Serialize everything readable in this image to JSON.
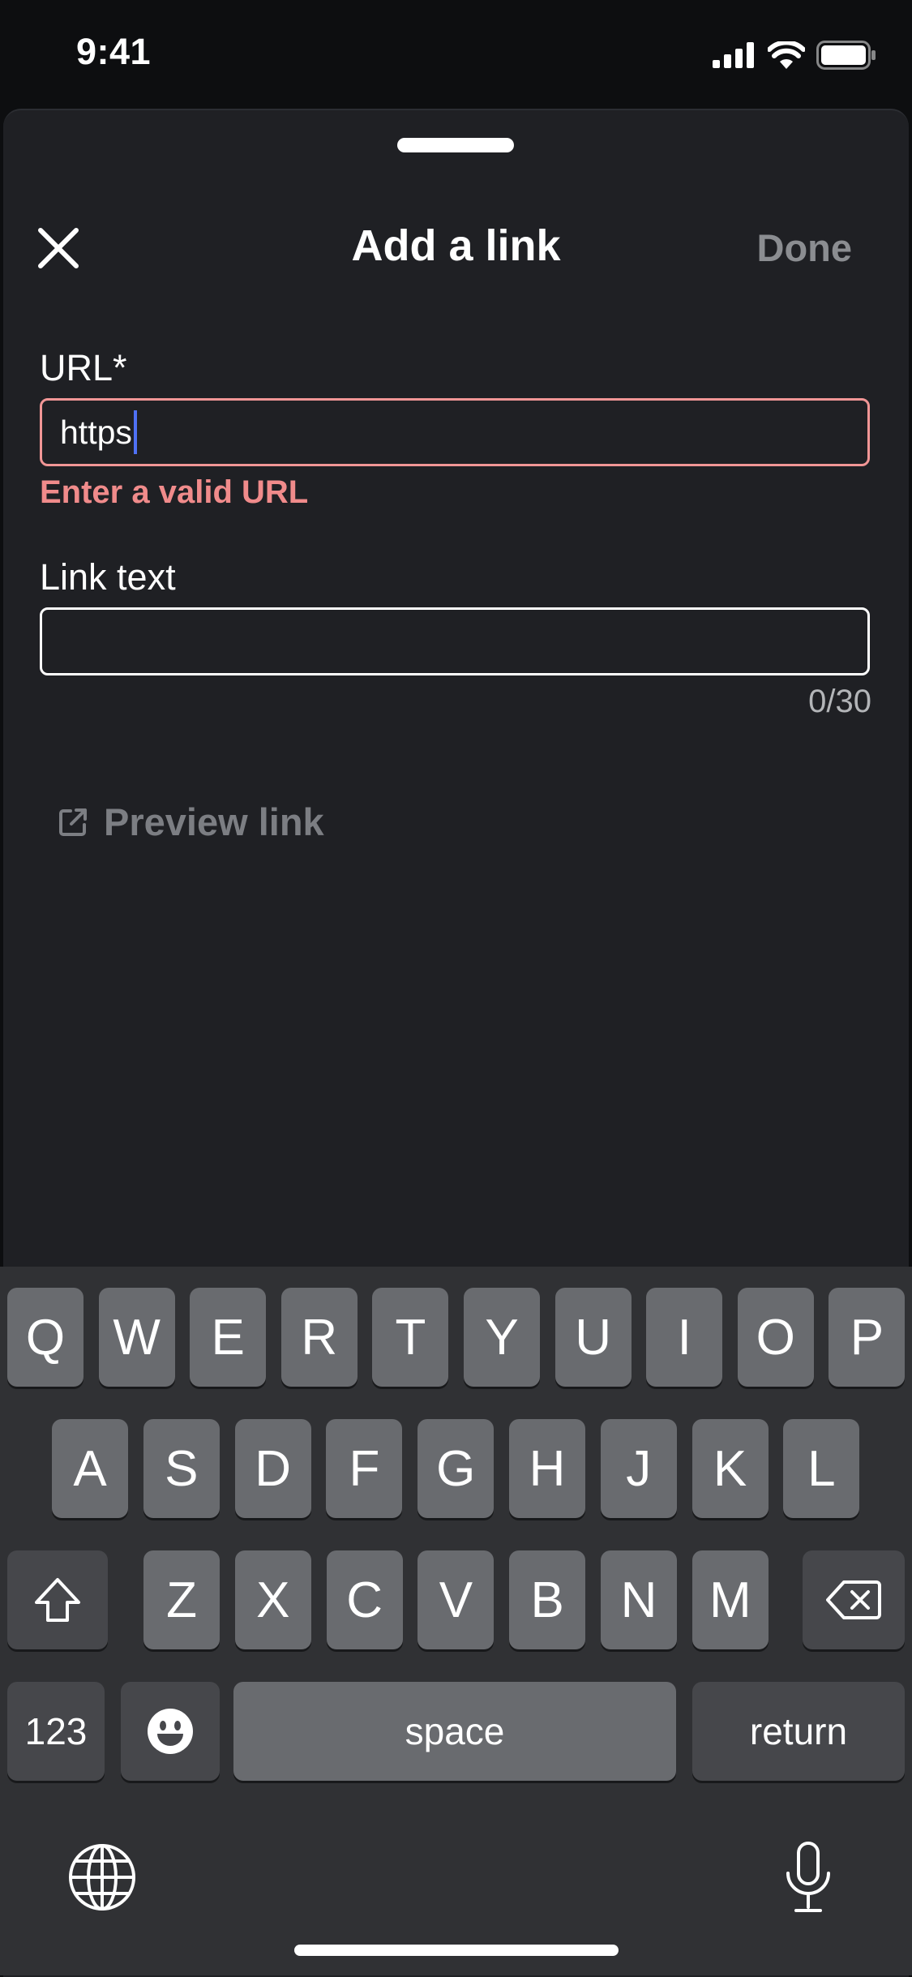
{
  "status_bar": {
    "time": "9:41"
  },
  "header": {
    "title": "Add a link",
    "done_label": "Done"
  },
  "url_field": {
    "label": "URL*",
    "value": "https",
    "error": "Enter a valid URL"
  },
  "link_text_field": {
    "label": "Link text",
    "value": "",
    "counter": "0/30"
  },
  "preview": {
    "label": "Preview link"
  },
  "keyboard": {
    "row1": [
      "Q",
      "W",
      "E",
      "R",
      "T",
      "Y",
      "U",
      "I",
      "O",
      "P"
    ],
    "row2": [
      "A",
      "S",
      "D",
      "F",
      "G",
      "H",
      "J",
      "K",
      "L"
    ],
    "row3": [
      "Z",
      "X",
      "C",
      "V",
      "B",
      "N",
      "M"
    ],
    "numbers_label": "123",
    "space_label": "space",
    "return_label": "return"
  },
  "colors": {
    "error": "#f08b8b",
    "caret": "#4f71f5",
    "sheet_background": "#1f2024",
    "key": "#696b6f",
    "dark_key": "#46474b"
  }
}
